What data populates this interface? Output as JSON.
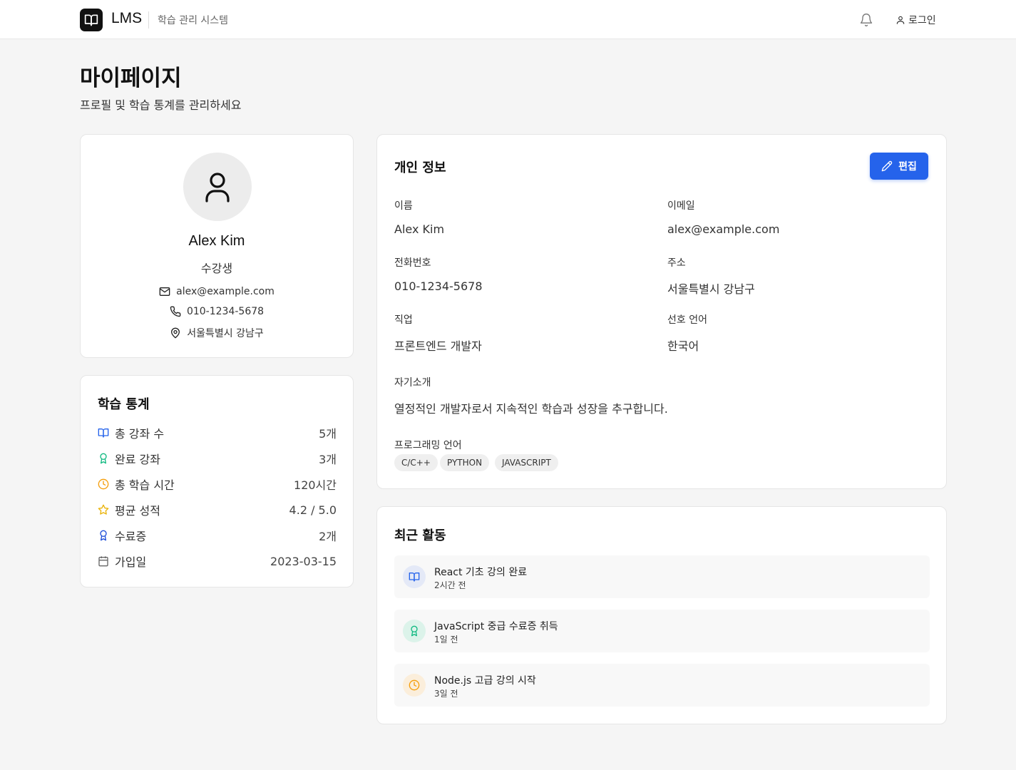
{
  "header": {
    "logo_text": "LMS",
    "subtitle": "학습 관리 시스템",
    "login_label": "로그인"
  },
  "page": {
    "title": "마이페이지",
    "subtitle": "프로필 및 학습 통계를 관리하세요"
  },
  "profile": {
    "name": "Alex Kim",
    "role": "수강생",
    "email": "alex@example.com",
    "phone": "010-1234-5678",
    "address": "서울특별시 강남구"
  },
  "stats": {
    "title": "학습 통계",
    "rows": [
      {
        "icon": "book-icon",
        "label": "총 강좌 수",
        "value": "5개",
        "color": "#2563eb"
      },
      {
        "icon": "award-icon",
        "label": "완료 강좌",
        "value": "3개",
        "color": "#10b981"
      },
      {
        "icon": "clock-icon",
        "label": "총 학습 시간",
        "value": "120시간",
        "color": "#f59e0b"
      },
      {
        "icon": "star-icon",
        "label": "평균 성적",
        "value": "4.2 / 5.0",
        "color": "#eab308"
      },
      {
        "icon": "certificate-icon",
        "label": "수료증",
        "value": "2개",
        "color": "#1d4ed8"
      },
      {
        "icon": "calendar-icon",
        "label": "가입일",
        "value": "2023-03-15",
        "color": "#666666"
      }
    ]
  },
  "info": {
    "title": "개인 정보",
    "edit_label": "편집",
    "name_label": "이름",
    "name_value": "Alex Kim",
    "email_label": "이메일",
    "email_value": "alex@example.com",
    "phone_label": "전화번호",
    "phone_value": "010-1234-5678",
    "address_label": "주소",
    "address_value": "서울특별시 강남구",
    "job_label": "직업",
    "job_value": "프론트엔드 개발자",
    "language_label": "선호 언어",
    "language_value": "한국어",
    "bio_label": "자기소개",
    "bio_value": "열정적인 개발자로서 지속적인 학습과 성장을 추구합니다.",
    "prog_label": "프로그래밍 언어",
    "tags": [
      "C/C++",
      "PYTHON",
      "JAVASCRIPT"
    ]
  },
  "activity": {
    "title": "최근 활동",
    "items": [
      {
        "icon": "book-icon",
        "title": "React 기초 강의 완료",
        "time": "2시간 전",
        "color": "#2563eb",
        "bg": "#e4e9f7"
      },
      {
        "icon": "award-icon",
        "title": "JavaScript 중급 수료증 취득",
        "time": "1일 전",
        "color": "#10b981",
        "bg": "#dcf3ea"
      },
      {
        "icon": "clock-icon",
        "title": "Node.js 고급 강의 시작",
        "time": "3일 전",
        "color": "#f59e0b",
        "bg": "#fbeedb"
      }
    ]
  },
  "colors": {
    "accent": "#2563eb",
    "background": "#f5f5f5",
    "card": "#ffffff"
  }
}
